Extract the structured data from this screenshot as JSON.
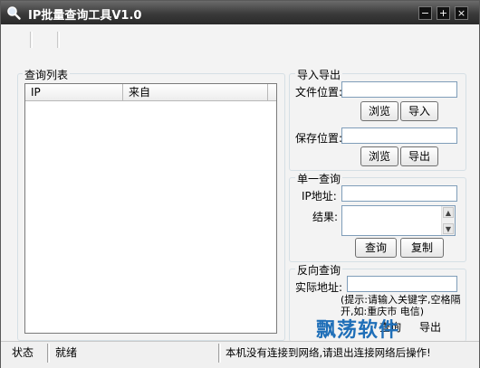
{
  "window": {
    "title": "IP批量查询工具V1.0",
    "controls": {
      "minimize": "−",
      "maximize": "+",
      "close": "×"
    }
  },
  "query_list": {
    "legend": "查询列表",
    "columns": [
      "IP",
      "来自"
    ]
  },
  "import_export": {
    "legend": "导入导出",
    "file_label": "文件位置:",
    "file_value": "",
    "browse1": "浏览",
    "import": "导入",
    "save_label": "保存位置:",
    "save_value": "",
    "browse2": "浏览",
    "export": "导出"
  },
  "single_query": {
    "legend": "单一查询",
    "ip_label": "IP地址:",
    "ip_value": "",
    "result_label": "结果:",
    "result_value": "",
    "query": "查询",
    "copy": "复制"
  },
  "reverse_query": {
    "legend": "反向查询",
    "address_label": "实际地址:",
    "address_value": "",
    "hint": "(提示:请输入关键字,空格隔开,如:重庆市 电信)",
    "query": "查询",
    "export": "导出"
  },
  "statusbar": {
    "status_label": "状态",
    "status_value": "就绪",
    "message": "本机没有连接到网络,请退出连接网络后操作!"
  },
  "watermark": "飘荡软件",
  "colors": {
    "titlebar": "#3a3a3a",
    "panel": "#f3f3f3",
    "watermark": "#1f6fb8"
  }
}
